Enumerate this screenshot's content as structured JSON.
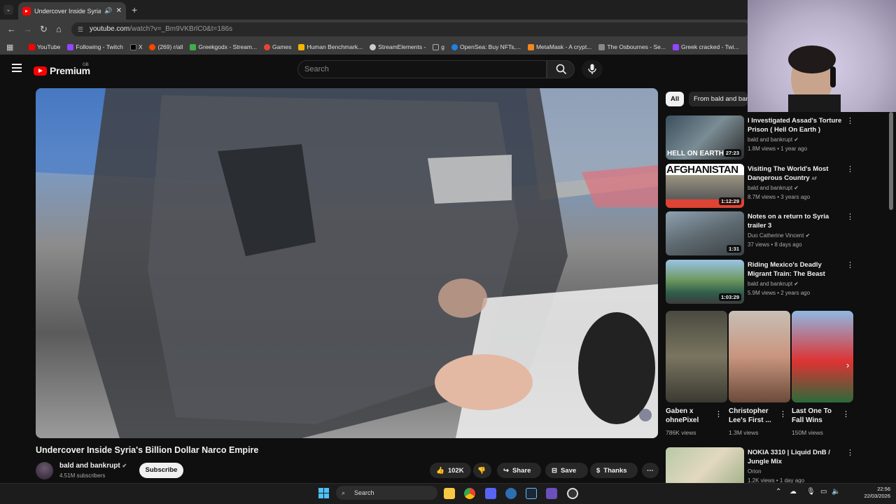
{
  "browser": {
    "tab_title": "Undercover Inside Syria's Bi",
    "url": "youtube.com",
    "url_path": "/watch?v=_Bm9VKBrlC0&t=186s",
    "bookmarks": [
      {
        "label": "YouTube",
        "color": "#ff0000"
      },
      {
        "label": "Following - Twitch",
        "color": "#9146ff"
      },
      {
        "label": "X",
        "color": "#000000"
      },
      {
        "label": "(269) r/all",
        "color": "#ff4500"
      },
      {
        "label": "Greekgodx - Stream...",
        "color": "#3fae49"
      },
      {
        "label": "Games",
        "color": "#ea4335"
      },
      {
        "label": "Human Benchmark...",
        "color": "#f4b400"
      },
      {
        "label": "StreamElements -",
        "color": "#cccccc"
      },
      {
        "label": "g",
        "color": "#aaaaaa"
      },
      {
        "label": "OpenSea: Buy NFTs,...",
        "color": "#2081e2"
      },
      {
        "label": "MetaMask - A crypt...",
        "color": "#f6851b"
      },
      {
        "label": "The Osbournes - Se...",
        "color": "#888888"
      },
      {
        "label": "Greek cracked - Twi...",
        "color": "#9146ff"
      }
    ]
  },
  "header": {
    "brand": "Premium",
    "region": "GB",
    "search_placeholder": "Search"
  },
  "video": {
    "title": "Undercover Inside Syria's Billion Dollar Narco Empire",
    "channel": "bald and bankrupt",
    "subscribers": "4.51M subscribers",
    "subscribe_label": "Subscribe",
    "likes": "102K",
    "share_label": "Share",
    "save_label": "Save",
    "thanks_label": "Thanks"
  },
  "chips": [
    {
      "label": "All"
    },
    {
      "label": "From bald and bankrupt"
    }
  ],
  "recommendations": [
    {
      "title": "I Investigated Assad's Torture Prison ( Hell On Earth )",
      "channel": "bald and bankrupt",
      "meta": "1.8M views • 1 year ago",
      "duration": "27:23",
      "thumb_text": "HELL ON EARTH"
    },
    {
      "title": "Visiting The World's Most Dangerous Country",
      "badge": "AF",
      "channel": "bald and bankrupt",
      "meta": "8.7M views • 3 years ago",
      "duration": "1:12:29",
      "thumb_text": "AFGHANISTAN"
    },
    {
      "title": "Notes on a return to Syria trailer 3",
      "channel": "Duo Catherine Vincent",
      "meta": "37 views • 8 days ago",
      "duration": "1:31",
      "thumb_text": ""
    },
    {
      "title": "Riding Mexico's Deadly Migrant Train: The Beast",
      "channel": "bald and bankrupt",
      "meta": "5.9M views • 2 years ago",
      "duration": "1:03:29",
      "thumb_text": ""
    }
  ],
  "shorts": [
    {
      "title": "Gaben x ohnePixel",
      "views": "786K views"
    },
    {
      "title": "Christopher Lee's First ...",
      "views": "1.3M views"
    },
    {
      "title": "Last One To Fall Wins",
      "views": "150M views"
    }
  ],
  "last_item": {
    "title": "NOKIA 3310 | Liquid DnB / Jungle Mix",
    "channel": "Orion",
    "meta": "1.2K views • 1 day ago"
  },
  "taskbar": {
    "search_label": "Search",
    "time": "22:56",
    "date": "22/03/2026"
  }
}
